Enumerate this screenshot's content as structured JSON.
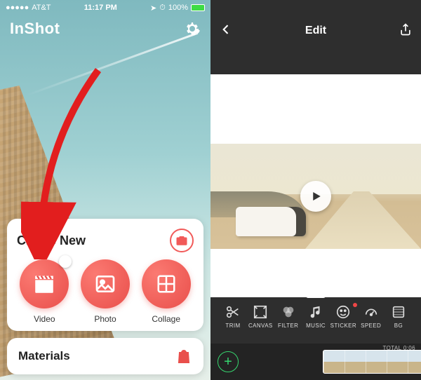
{
  "left": {
    "status": {
      "carrier": "AT&T",
      "time": "11:17 PM",
      "loc": "↗",
      "alarm": "⏰",
      "battery": "100%"
    },
    "brand": "InShot",
    "create_card": {
      "title": "Create New",
      "actions": [
        {
          "id": "video",
          "label": "Video",
          "icon": "clapper-icon"
        },
        {
          "id": "photo",
          "label": "Photo",
          "icon": "image-icon"
        },
        {
          "id": "collage",
          "label": "Collage",
          "icon": "collage-icon"
        }
      ]
    },
    "materials_card": {
      "title": "Materials"
    }
  },
  "right": {
    "header": {
      "title": "Edit"
    },
    "tools": [
      {
        "id": "trim",
        "label": "TRIM",
        "icon": "scissors-icon"
      },
      {
        "id": "canvas",
        "label": "CANVAS",
        "icon": "canvas-icon"
      },
      {
        "id": "filter",
        "label": "FILTER",
        "icon": "filter-icon"
      },
      {
        "id": "music",
        "label": "MUSIC",
        "icon": "music-icon"
      },
      {
        "id": "sticker",
        "label": "STICKER",
        "icon": "sticker-icon",
        "badge": true
      },
      {
        "id": "speed",
        "label": "SPEED",
        "icon": "speed-icon"
      },
      {
        "id": "bg",
        "label": "BG",
        "icon": "bg-icon"
      }
    ],
    "timeline": {
      "add": "+",
      "total_label": "TOTAL 0:06"
    }
  }
}
